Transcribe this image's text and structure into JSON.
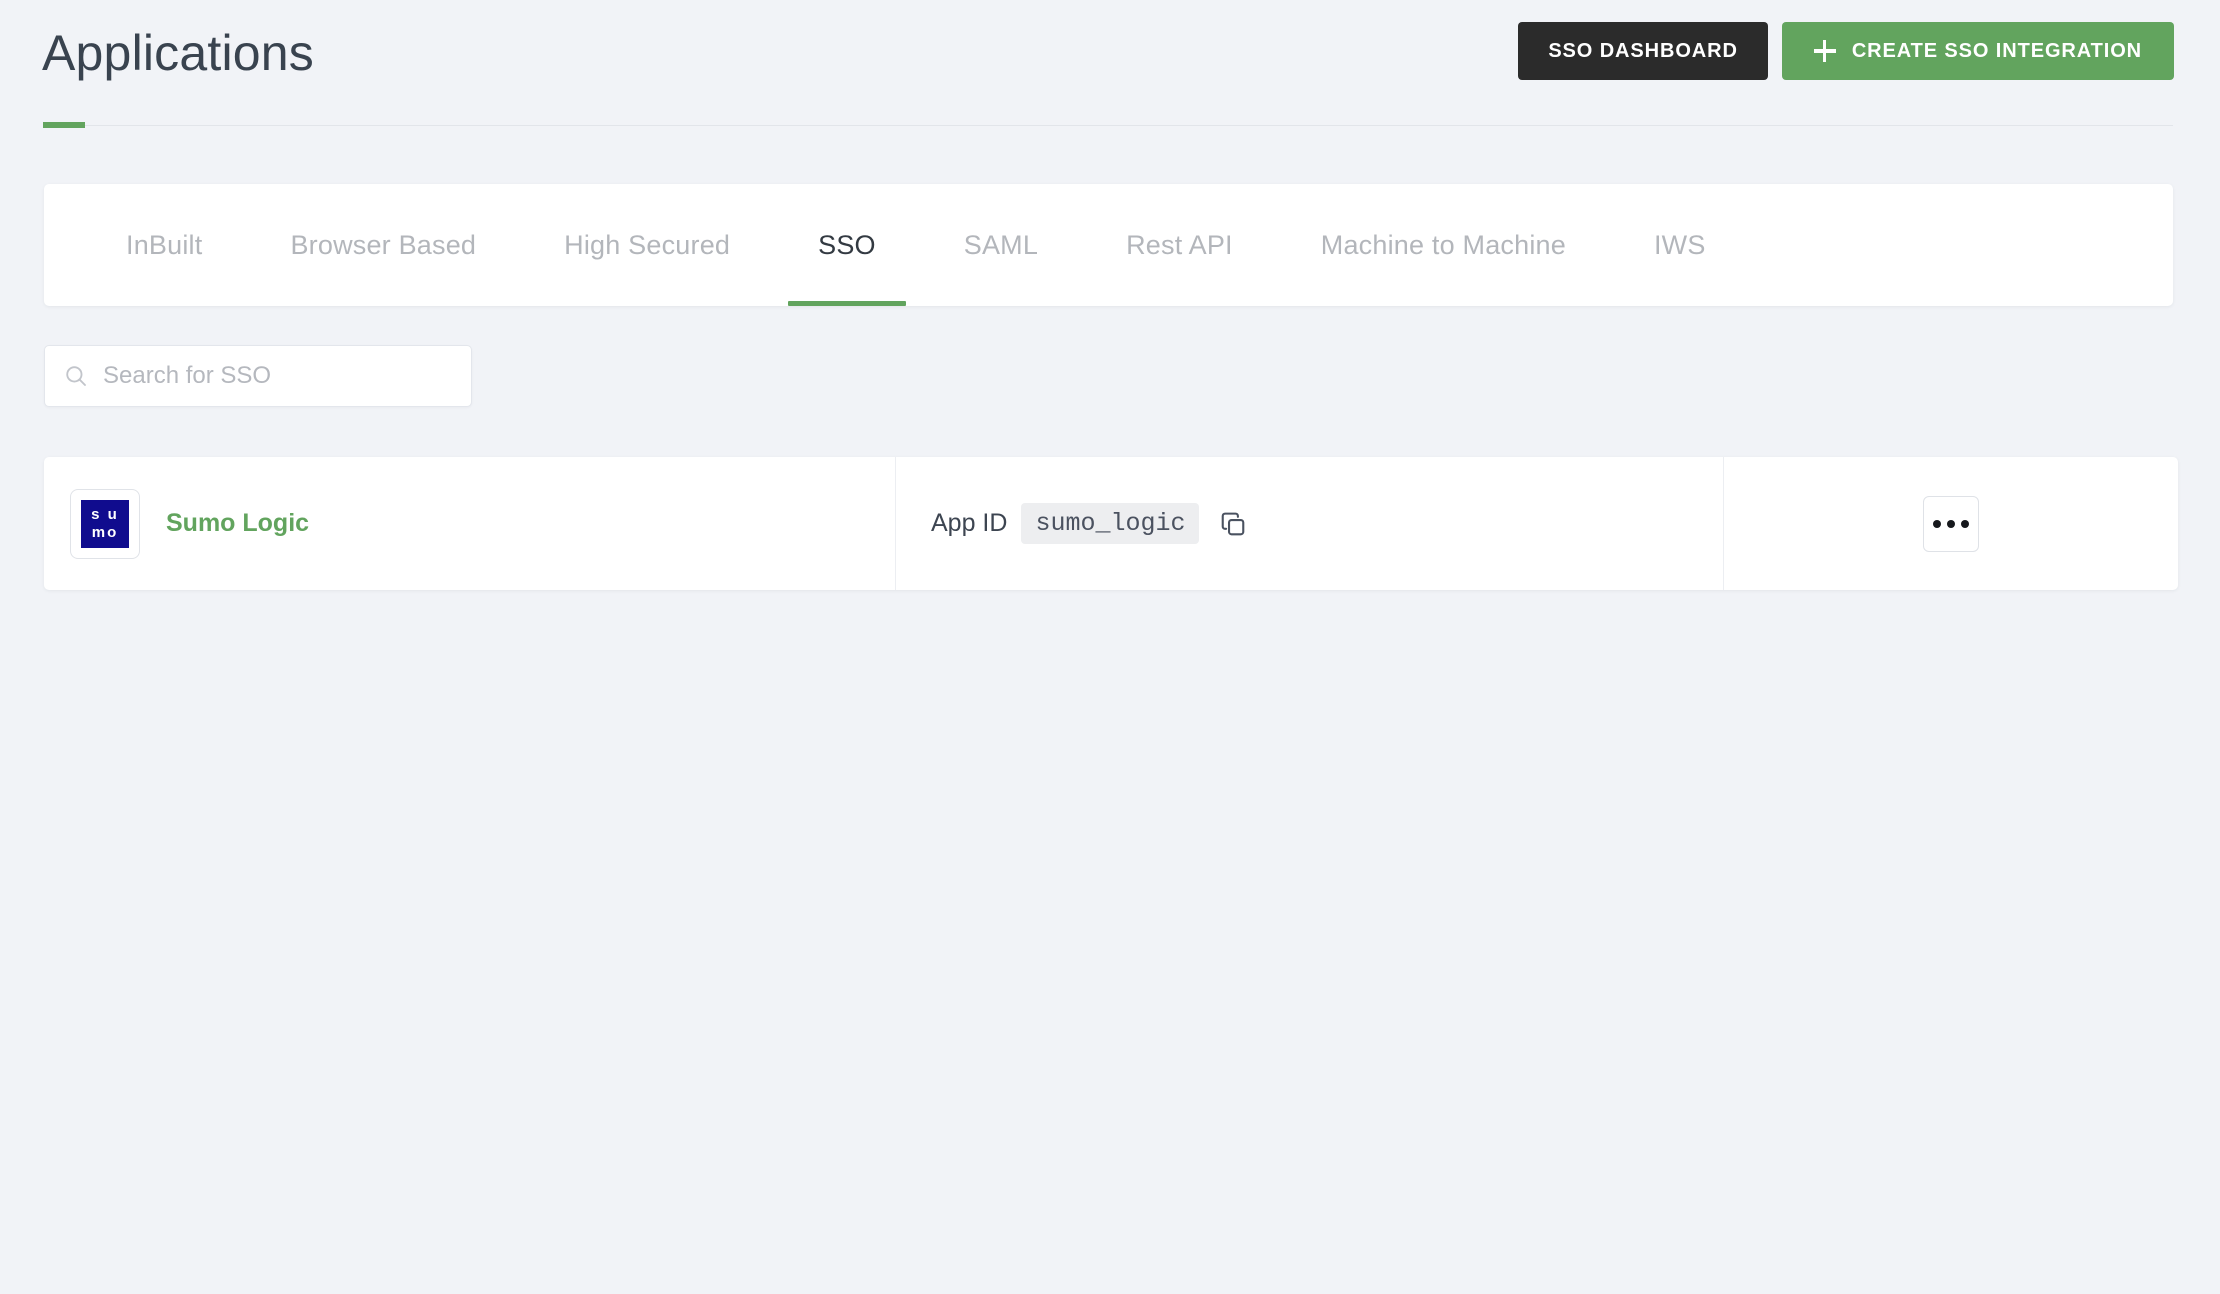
{
  "header": {
    "title": "Applications",
    "accent_color": "#62a45e",
    "buttons": [
      {
        "label": "SSO DASHBOARD",
        "style": "dark",
        "icon": null
      },
      {
        "label": "CREATE SSO INTEGRATION",
        "style": "green",
        "icon": "plus-icon"
      }
    ]
  },
  "tabs": {
    "active_index": 3,
    "items": [
      {
        "label": "InBuilt"
      },
      {
        "label": "Browser Based"
      },
      {
        "label": "High Secured"
      },
      {
        "label": "SSO"
      },
      {
        "label": "SAML"
      },
      {
        "label": "Rest API"
      },
      {
        "label": "Machine to Machine"
      },
      {
        "label": "IWS"
      }
    ]
  },
  "search": {
    "placeholder": "Search for SSO",
    "value": "",
    "icon": "search-icon"
  },
  "list": {
    "rows": [
      {
        "app_name": "Sumo Logic",
        "logo": {
          "type": "sumo-logic-logo",
          "line1": "s u",
          "line2": "mo",
          "background": "#100c8e",
          "text_color": "#ffffff"
        },
        "app_id_label": "App ID",
        "app_id_value": "sumo_logic",
        "copy_icon": "copy-icon",
        "menu_icon": "ellipsis-icon"
      }
    ]
  },
  "colors": {
    "page_background": "#f1f3f7",
    "accent_green": "#62a45e",
    "dark_button": "#2b2b2b",
    "title_text": "#39434f",
    "muted_tab_text": "#b3b6bb"
  }
}
